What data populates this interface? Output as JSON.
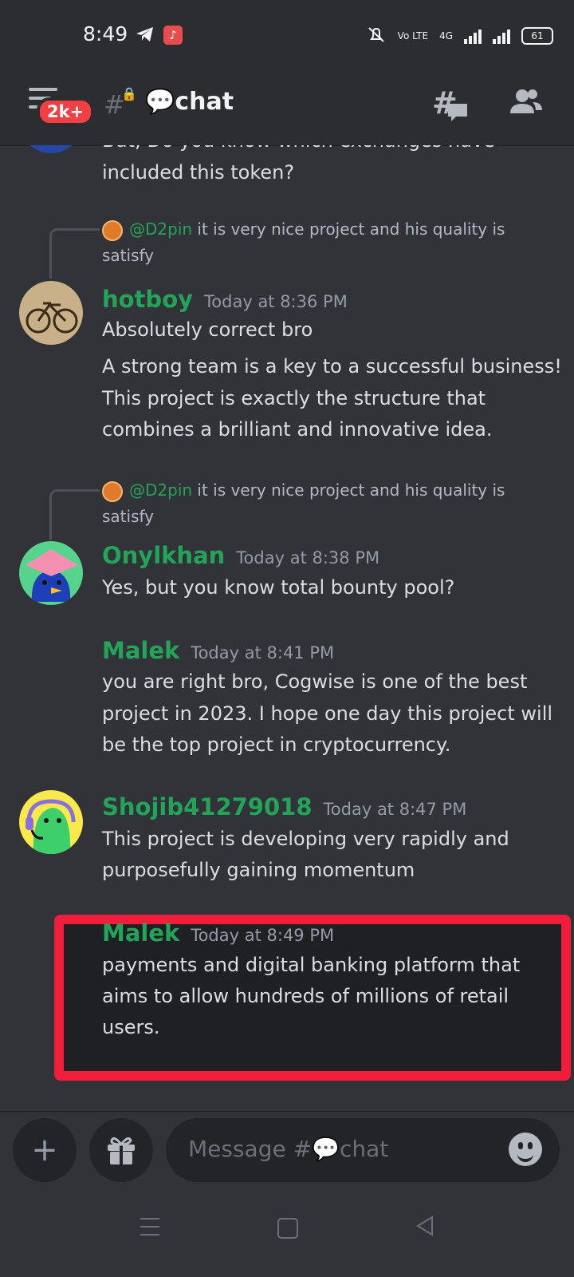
{
  "status_bar": {
    "time": "8:49",
    "battery": "61",
    "network": "4G",
    "volte": "Vo LTE"
  },
  "header": {
    "unread_badge": "2k+",
    "channel_name": "chat",
    "channel_emoji": "💬"
  },
  "messages": {
    "partial_top": {
      "line1": "But, Do you know which exchanges have",
      "line2": "included this token?"
    },
    "reply1": {
      "mention": "@D2pin",
      "text1": "it is very nice project and his quality is",
      "text2": "satisfy"
    },
    "m1": {
      "author": "hotboy",
      "time": "Today at 8:36 PM",
      "line1": "Absolutely correct bro",
      "line2": "A strong team is a key to a successful business!",
      "line3": "This project is exactly the structure that",
      "line4": "combines a brilliant and innovative idea."
    },
    "reply2": {
      "mention": "@D2pin",
      "text1": "it is very nice project and his quality is",
      "text2": "satisfy"
    },
    "m2": {
      "author": "Onylkhan",
      "time": "Today at 8:38 PM",
      "line1": "Yes, but you know total bounty pool?"
    },
    "m3": {
      "author": "Malek",
      "time": "Today at 8:41 PM",
      "line1": "you are right bro, Cogwise is one of the best",
      "line2": "project in 2023. I hope one day this project will",
      "line3": "be the top project in cryptocurrency."
    },
    "m4": {
      "author": "Shojib41279018",
      "time": "Today at 8:47 PM",
      "line1": "This project is developing very rapidly and",
      "line2": "purposefully gaining momentum"
    },
    "m5": {
      "author": "Malek",
      "time": "Today at 8:49 PM",
      "line1": "payments and digital banking platform that",
      "line2": "aims to allow hundreds of millions of retail",
      "line3": "users."
    }
  },
  "composer": {
    "placeholder": "Message #💬chat"
  },
  "colors": {
    "accent_green": "#23a559",
    "highlight_red": "#f01e3a",
    "badge_red": "#f23f43",
    "background": "#313338"
  }
}
